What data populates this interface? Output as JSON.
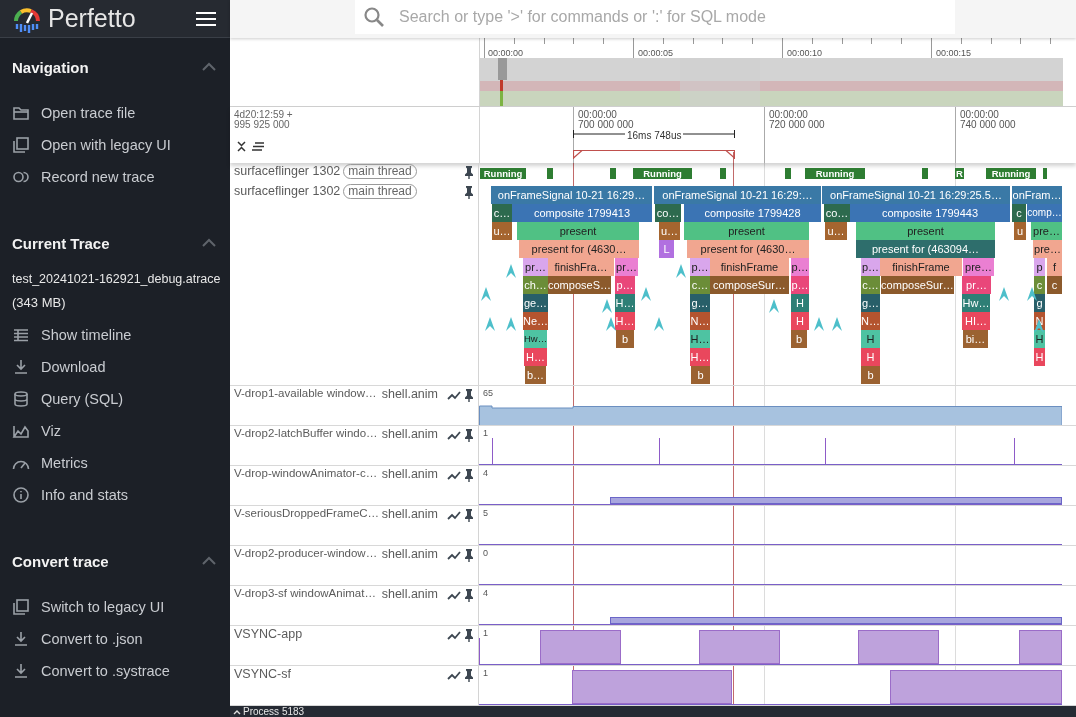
{
  "app": {
    "title": "Perfetto"
  },
  "sidebar": {
    "sections": [
      {
        "title": "Navigation",
        "expanded": true,
        "items": [
          {
            "label": "Open trace file"
          },
          {
            "label": "Open with legacy UI"
          },
          {
            "label": "Record new trace"
          }
        ]
      },
      {
        "title": "Current Trace",
        "expanded": true,
        "trace_name": "test_20241021-162921_debug.atrace",
        "trace_size": "(343 MB)",
        "items": [
          {
            "label": "Show timeline"
          },
          {
            "label": "Download"
          },
          {
            "label": "Query (SQL)"
          },
          {
            "label": "Viz"
          },
          {
            "label": "Metrics"
          },
          {
            "label": "Info and stats"
          }
        ]
      },
      {
        "title": "Convert trace",
        "expanded": true,
        "items": [
          {
            "label": "Switch to legacy UI"
          },
          {
            "label": "Convert to .json"
          },
          {
            "label": "Convert to .systrace"
          }
        ]
      }
    ]
  },
  "search": {
    "placeholder": "Search or type '>' for commands or ':' for SQL mode"
  },
  "overview": {
    "ticks": [
      "00:00:00",
      "00:00:05",
      "00:00:10",
      "00:00:15"
    ]
  },
  "ruler": {
    "offset": "4d20:12:59  +",
    "offset_ns": "995 925 000",
    "ticks": [
      {
        "time": "00:00:00",
        "ns": "700 000 000"
      },
      {
        "time": "00:00:00",
        "ns": "720 000 000"
      },
      {
        "time": "00:00:00",
        "ns": "740 000 000"
      }
    ],
    "measurement": "16ms 748us"
  },
  "thread_tracks": [
    {
      "name": "surfaceflinger 1302",
      "tag": "main thread",
      "kind": "states",
      "states": [
        {
          "kind": "running",
          "label": "Running"
        },
        {
          "kind": "running"
        },
        {
          "kind": "running"
        },
        {
          "kind": "running",
          "label": "Running"
        },
        {
          "kind": "running"
        },
        {
          "kind": "running"
        },
        {
          "kind": "running",
          "label": "Running"
        },
        {
          "kind": "running"
        },
        {
          "kind": "running",
          "label": "R"
        },
        {
          "kind": "running",
          "label": "Running"
        },
        {
          "kind": "running"
        }
      ]
    },
    {
      "name": "surfaceflinger 1302",
      "tag": "main thread",
      "kind": "slices",
      "frames": [
        {
          "rows": [
            [
              {
                "label": "onFrameSignal 10-21 16:29…",
                "color": "#3a79a6"
              }
            ],
            [
              {
                "label": "c…",
                "color": "#2d6a4e"
              },
              {
                "label": "composite 1799413",
                "color": "#3b74b4"
              }
            ],
            [
              {
                "label": "u…",
                "color": "#a5652f"
              },
              {
                "label": "present",
                "color": "#50c184"
              }
            ],
            [
              {
                "label": "present for  (4630…",
                "color": "#f1a690"
              }
            ],
            [
              {
                "label": "pr…",
                "color": "#d9a6ec"
              },
              {
                "label": "finishFra…",
                "color": "#f1a690"
              },
              {
                "label": "pr…",
                "color": "#ea7fd2"
              }
            ],
            [
              {
                "label": "ch…",
                "color": "#6b8d38"
              },
              {
                "label": "composeS…",
                "color": "#8c5a2c"
              },
              {
                "label": "p…",
                "color": "#e9477a"
              }
            ],
            [
              {
                "label": "ge…",
                "color": "#285f69"
              },
              {
                "label": "H…",
                "color": "#2e7f76"
              }
            ],
            [
              {
                "label": "Ne…",
                "color": "#b4542f"
              },
              {
                "label": "H…",
                "color": "#e9475d"
              }
            ],
            [
              {
                "label": "Hw…",
                "color": "#4ec3a2"
              },
              {
                "label": "b",
                "color": "#9b6231"
              }
            ],
            [
              {
                "label": "H…",
                "color": "#e9475d"
              }
            ],
            [
              {
                "label": "b…",
                "color": "#9b6231"
              }
            ]
          ]
        },
        {
          "rows": [
            [
              {
                "label": "onFrameSignal 10-21 16:29:…",
                "color": "#3a79a6"
              }
            ],
            [
              {
                "label": "co…",
                "color": "#2d6a4e"
              },
              {
                "label": "composite 1799428",
                "color": "#3b74b4"
              }
            ],
            [
              {
                "label": "u…",
                "color": "#a5652f"
              },
              {
                "label": "present",
                "color": "#50c184"
              }
            ],
            [
              {
                "label": "L",
                "color": "#b170e0"
              },
              {
                "label": "present for  (4630…",
                "color": "#f1a690"
              }
            ],
            [
              {
                "label": "p…",
                "color": "#d9a6ec"
              },
              {
                "label": "finishFrame",
                "color": "#f1a690"
              },
              {
                "label": "p…",
                "color": "#ea7fd2"
              }
            ],
            [
              {
                "label": "c…",
                "color": "#6b8d38"
              },
              {
                "label": "composeSur…",
                "color": "#8c5a2c"
              },
              {
                "label": "p…",
                "color": "#e9477a"
              }
            ],
            [
              {
                "label": "g…",
                "color": "#285f69"
              },
              {
                "label": "H",
                "color": "#2e7f76"
              }
            ],
            [
              {
                "label": "N…",
                "color": "#b4542f"
              },
              {
                "label": "H",
                "color": "#e9475d"
              }
            ],
            [
              {
                "label": "H…",
                "color": "#4ec3a2"
              },
              {
                "label": "b",
                "color": "#9b6231"
              }
            ],
            [
              {
                "label": "H…",
                "color": "#e9475d"
              }
            ],
            [
              {
                "label": "b",
                "color": "#9b6231"
              }
            ]
          ]
        },
        {
          "rows": [
            [
              {
                "label": "onFrameSignal 10-21 16:29:25.5…",
                "color": "#3a79a6"
              }
            ],
            [
              {
                "label": "co…",
                "color": "#2d6a4e"
              },
              {
                "label": "composite 1799443",
                "color": "#3b74b4"
              }
            ],
            [
              {
                "label": "u…",
                "color": "#a5652f"
              },
              {
                "label": "present",
                "color": "#50c184"
              }
            ],
            [
              {
                "label": "present for  (463094…",
                "color": "#2e6e6c"
              }
            ],
            [
              {
                "label": "p…",
                "color": "#d9a6ec"
              },
              {
                "label": "finishFrame",
                "color": "#f1a690"
              },
              {
                "label": "pre…",
                "color": "#ea7fd2"
              }
            ],
            [
              {
                "label": "c…",
                "color": "#6b8d38"
              },
              {
                "label": "composeSur…",
                "color": "#8c5a2c"
              },
              {
                "label": "pr…",
                "color": "#e9477a"
              }
            ],
            [
              {
                "label": "g…",
                "color": "#285f69"
              },
              {
                "label": "Hw…",
                "color": "#2e7f76"
              }
            ],
            [
              {
                "label": "N…",
                "color": "#b4542f"
              },
              {
                "label": "HI…",
                "color": "#e9475d"
              }
            ],
            [
              {
                "label": "H",
                "color": "#4ec3a2"
              },
              {
                "label": "bi…",
                "color": "#9b6231"
              }
            ],
            [
              {
                "label": "H",
                "color": "#e9475d"
              }
            ],
            [
              {
                "label": "b",
                "color": "#9b6231"
              }
            ]
          ]
        },
        {
          "rows": [
            [
              {
                "label": "onFram…",
                "color": "#3a79a6"
              }
            ],
            [
              {
                "label": "c",
                "color": "#2d6a4e"
              },
              {
                "label": "comp…",
                "color": "#3b74b4"
              }
            ],
            [
              {
                "label": "u",
                "color": "#a5652f"
              },
              {
                "label": "pre…",
                "color": "#50c184"
              }
            ],
            [
              {
                "label": "pre…",
                "color": "#f1a690"
              }
            ],
            [
              {
                "label": "p",
                "color": "#d9a6ec"
              },
              {
                "label": "f",
                "color": "#f1a690"
              }
            ],
            [
              {
                "label": "c",
                "color": "#6b8d38"
              },
              {
                "label": "c",
                "color": "#8c5a2c"
              }
            ],
            [
              {
                "label": "g",
                "color": "#285f69"
              }
            ],
            [
              {
                "label": "N",
                "color": "#b4542f"
              }
            ],
            [
              {
                "label": "H",
                "color": "#4ec3a2"
              }
            ],
            [
              {
                "label": "H",
                "color": "#e9475d"
              }
            ]
          ]
        }
      ]
    }
  ],
  "counter_tracks": [
    {
      "name": "V-drop1-available window…",
      "process": "shell.anim",
      "max": "65"
    },
    {
      "name": "V-drop2-latchBuffer windo…",
      "process": "shell.anim",
      "max": "1"
    },
    {
      "name": "V-drop-windowAnimator-c…",
      "process": "shell.anim",
      "max": "4"
    },
    {
      "name": "V-seriousDroppedFrameC…",
      "process": "shell.anim",
      "max": "5"
    },
    {
      "name": "V-drop2-producer-window…",
      "process": "shell.anim",
      "max": "0"
    },
    {
      "name": "V-drop3-sf windowAnimat…",
      "process": "shell.anim",
      "max": "4"
    },
    {
      "name": "VSYNC-app",
      "max": "1"
    },
    {
      "name": "VSYNC-sf",
      "max": "1"
    }
  ],
  "process_group": {
    "title": "Process 5183"
  }
}
